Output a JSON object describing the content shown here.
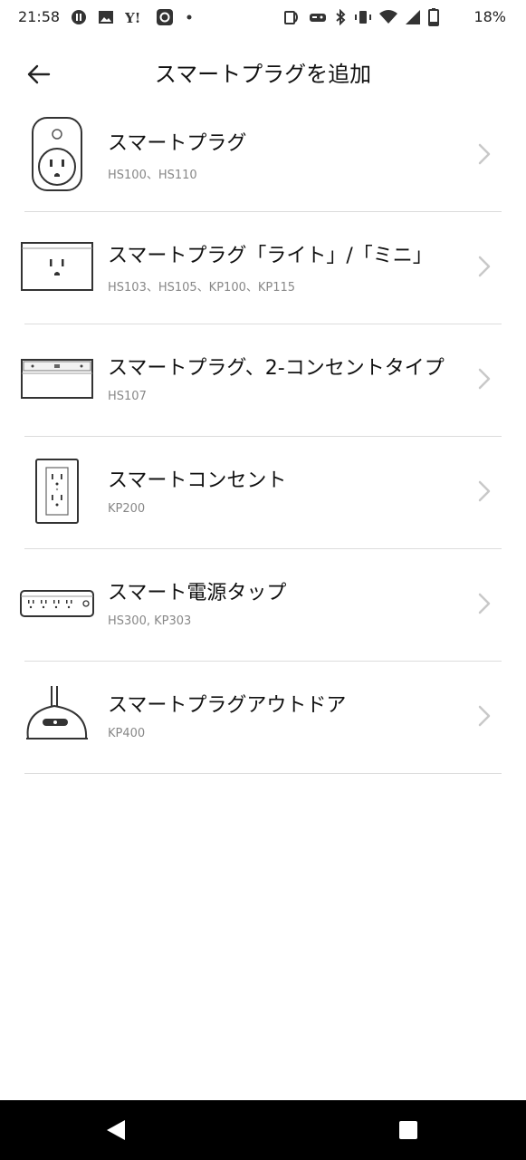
{
  "status_bar": {
    "time": "21:58",
    "battery_percent": "18%",
    "left_icons": [
      "pause-circle-icon",
      "image-icon",
      "yahoo-icon",
      "lens-icon",
      "dot-icon"
    ],
    "right_icons": [
      "nfc-icon",
      "game-icon",
      "bluetooth-icon",
      "vibrate-icon",
      "wifi-icon",
      "cell-signal-icon",
      "battery-icon"
    ]
  },
  "header": {
    "title": "スマートプラグを追加",
    "back_icon": "arrow-left-icon"
  },
  "devices": [
    {
      "title": "スマートプラグ",
      "models": "HS100、HS110",
      "icon": "smart-plug-round-icon"
    },
    {
      "title": "スマートプラグ「ライト」/「ミニ」",
      "models": "HS103、HS105、KP100、KP115",
      "icon": "smart-plug-mini-icon"
    },
    {
      "title": "スマートプラグ、2-コンセントタイプ",
      "models": "HS107",
      "icon": "smart-plug-dual-icon"
    },
    {
      "title": "スマートコンセント",
      "models": "KP200",
      "icon": "wall-outlet-icon"
    },
    {
      "title": "スマート電源タップ",
      "models": "HS300, KP303",
      "icon": "power-strip-icon"
    },
    {
      "title": "スマートプラグアウトドア",
      "models": "KP400",
      "icon": "outdoor-plug-icon"
    }
  ],
  "nav_bar": {
    "back_icon": "nav-back-triangle-icon",
    "recents_icon": "nav-recents-square-icon"
  }
}
